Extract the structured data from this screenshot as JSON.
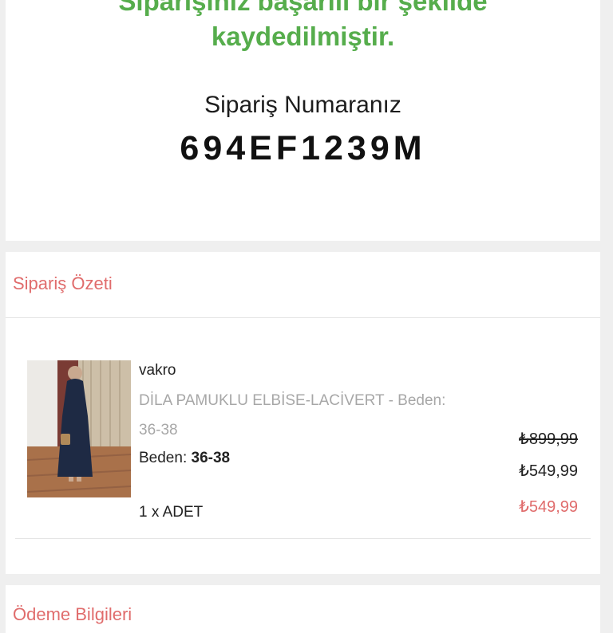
{
  "success": {
    "line1": "Siparişiniz başarılı bir şekilde",
    "line2": "kaydedilmiştir.",
    "order_label": "Sipariş Numaranız",
    "order_number": "694EF1239M"
  },
  "summary": {
    "title": "Sipariş Özeti",
    "product": {
      "brand": "vakro",
      "name": "DİLA PAMUKLU ELBİSE-LACİVERT - Beden: 36-38",
      "size_label": "Beden: ",
      "size_value": "36-38",
      "quantity": "1 x ADET",
      "price_old": "₺899,99",
      "price_current": "₺549,99",
      "price_total": "₺549,99"
    }
  },
  "payment": {
    "title": "Ödeme Bilgileri"
  },
  "colors": {
    "success": "#56ad4c",
    "accent": "#e06c6c"
  }
}
